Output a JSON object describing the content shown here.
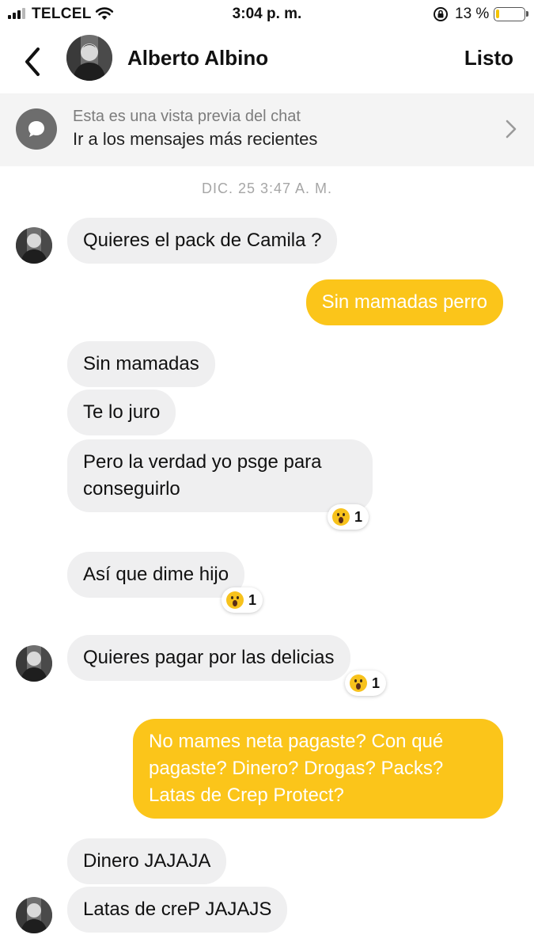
{
  "status_bar": {
    "carrier": "TELCEL",
    "time": "3:04 p. m.",
    "battery_percent": "13 %",
    "battery_level": 0.13
  },
  "header": {
    "contact_name": "Alberto Albino",
    "done_label": "Listo",
    "back_icon": "chevron-left-icon"
  },
  "preview": {
    "subtitle": "Esta es una vista previa del chat",
    "title": "Ir a los mensajes más recientes",
    "icon": "chat-bubble-icon"
  },
  "chat": {
    "date_stamp": "DIC. 25 3:47 A. M.",
    "messages": [
      {
        "sender": "them",
        "text": "Quieres el pack de Camila ?"
      },
      {
        "sender": "me",
        "text": "Sin mamadas perro"
      },
      {
        "sender": "them",
        "text": "Sin mamadas"
      },
      {
        "sender": "them",
        "text": "Te lo juro"
      },
      {
        "sender": "them",
        "text": [
          "Pero la verdad yo psge para",
          "conseguirlo"
        ],
        "reaction": {
          "emoji": "astonished-face",
          "count": "1"
        }
      },
      {
        "sender": "them",
        "text": "Así que dime hijo",
        "reaction": {
          "emoji": "astonished-face",
          "count": "1"
        }
      },
      {
        "sender": "them",
        "text": "Quieres pagar por las delicias",
        "reaction": {
          "emoji": "astonished-face",
          "count": "1"
        }
      },
      {
        "sender": "me",
        "text": [
          "No mames neta pagaste? Con qué",
          "pagaste? Dinero? Drogas? Packs?",
          "Latas de Crep Protect?"
        ]
      },
      {
        "sender": "them",
        "text": "Dinero JAJAJA"
      },
      {
        "sender": "them",
        "text": "Latas de creP JAJAJS"
      }
    ]
  },
  "colors": {
    "outgoing_bubble": "#fbc51a",
    "incoming_bubble": "#efeff0",
    "preview_banner": "#f4f4f4",
    "battery_fill": "#f5c400"
  }
}
